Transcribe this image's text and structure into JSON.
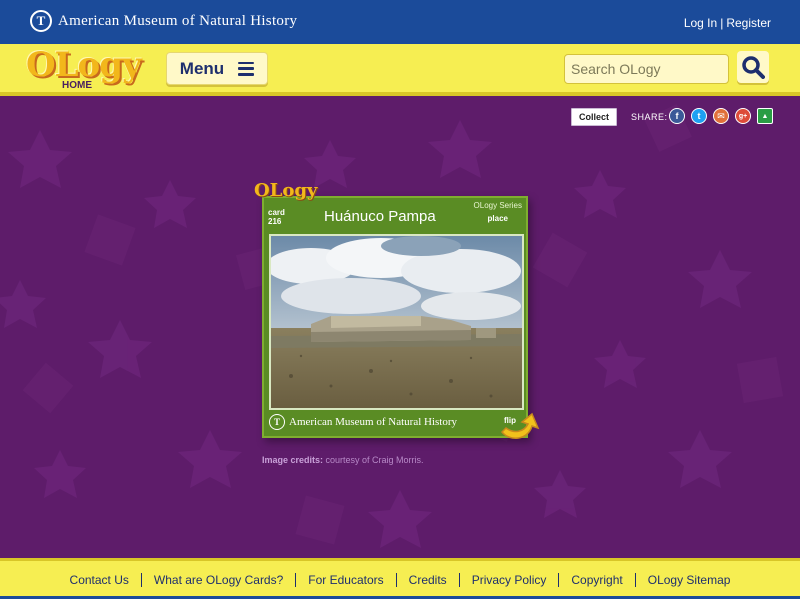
{
  "topbar": {
    "museum_name": "American Museum of Natural History",
    "museum_logo_glyph": "T",
    "login_label": "Log In",
    "separator": "|",
    "register_label": "Register"
  },
  "header": {
    "logo_text": "OLogy",
    "logo_home": "HOME",
    "menu_label": "Menu",
    "search_placeholder": "Search OLogy"
  },
  "share": {
    "collect_label": "Collect",
    "share_label": "SHARE:",
    "icons": [
      {
        "name": "facebook-icon",
        "glyph": "f",
        "color": "#3b5998"
      },
      {
        "name": "twitter-icon",
        "glyph": "t",
        "color": "#1da1f2"
      },
      {
        "name": "email-icon",
        "glyph": "✉",
        "color": "#e0703a"
      },
      {
        "name": "google-plus-icon",
        "glyph": "g+",
        "color": "#dd4b39"
      },
      {
        "name": "google-classroom-icon",
        "glyph": "▲",
        "color": "#2a9d45"
      }
    ]
  },
  "card": {
    "logo_text": "OLogy",
    "card_label": "card",
    "card_number": "216",
    "title": "Huánuco Pampa",
    "series": "OLogy Series",
    "type": "place",
    "museum_name": "American Museum of Natural History",
    "flip_label": "flip"
  },
  "credits": {
    "label": "Image credits:",
    "text": " courtesy of Craig Morris."
  },
  "footer": {
    "links": [
      "Contact Us",
      "What are OLogy Cards?",
      "For Educators",
      "Credits",
      "Privacy Policy",
      "Copyright",
      "OLogy Sitemap"
    ]
  },
  "colors": {
    "background": "#5e1c6a",
    "topbar": "#1b4b9a",
    "header": "#f6ee52",
    "card": "#5a8c24"
  }
}
